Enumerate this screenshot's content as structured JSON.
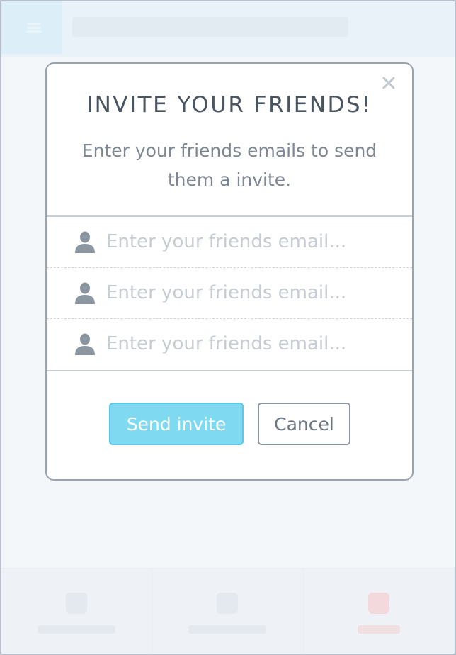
{
  "modal": {
    "title": "INVITE YOUR FRIENDS!",
    "subtitle": "Enter your friends emails to send them a invite.",
    "close_icon": "close-icon",
    "emails": [
      {
        "value": "",
        "placeholder": "Enter your friends email..."
      },
      {
        "value": "",
        "placeholder": "Enter your friends email..."
      },
      {
        "value": "",
        "placeholder": "Enter your friends email..."
      }
    ],
    "row_icon": "user-icon",
    "send_label": "Send invite",
    "cancel_label": "Cancel"
  },
  "colors": {
    "accent": "#7fdaf1",
    "accent_border": "#5cc8e6",
    "title": "#4a5562",
    "muted_text": "#7e8793",
    "placeholder": "#c6ccd3",
    "icon": "#8c96a1",
    "frame_border": "#b7c0cb"
  }
}
